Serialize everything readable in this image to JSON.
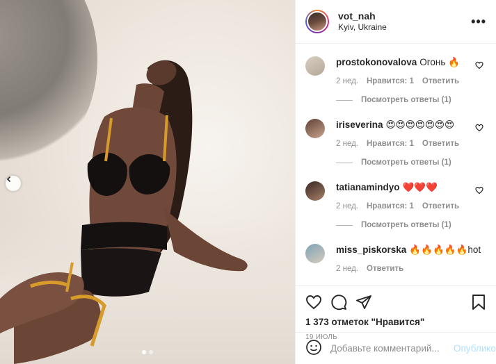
{
  "post": {
    "username": "vot_nah",
    "location": "Kyiv, Ukraine",
    "more_icon": "more-dots-icon",
    "likes_text": "1 373 отметок \"Нравится\"",
    "date": "19 ИЮЛЬ"
  },
  "carousel": {
    "prev_icon": "chevron-left-icon",
    "dot_count": 2,
    "active_dot": 0
  },
  "comments": [
    {
      "user": "prostokonovalova",
      "text": "Огонь 🔥",
      "time": "2 нед.",
      "likes": "Нравится: 1",
      "reply": "Ответить",
      "replies": "Посмотреть ответы (1)"
    },
    {
      "user": "iriseverina",
      "text": "😍😍😍😍😍😍😍",
      "time": "2 нед.",
      "likes": "Нравится: 1",
      "reply": "Ответить",
      "replies": "Посмотреть ответы (1)"
    },
    {
      "user": "tatianamindyo",
      "text": "❤️❤️❤️",
      "time": "2 нед.",
      "likes": "Нравится: 1",
      "reply": "Ответить",
      "replies": "Посмотреть ответы (1)"
    },
    {
      "user": "miss_piskorska",
      "text": "🔥🔥🔥🔥🔥hot",
      "time": "2 нед.",
      "likes": "",
      "reply": "Ответить",
      "replies": ""
    }
  ],
  "actions": {
    "like_icon": "heart-icon",
    "comment_icon": "comment-bubble-icon",
    "share_icon": "paper-plane-icon",
    "save_icon": "bookmark-icon"
  },
  "composer": {
    "emoji_icon": "smiley-icon",
    "placeholder": "Добавьте комментарий...",
    "publish_label": "Опубликовать",
    "publish_color": "#b2dffc"
  }
}
